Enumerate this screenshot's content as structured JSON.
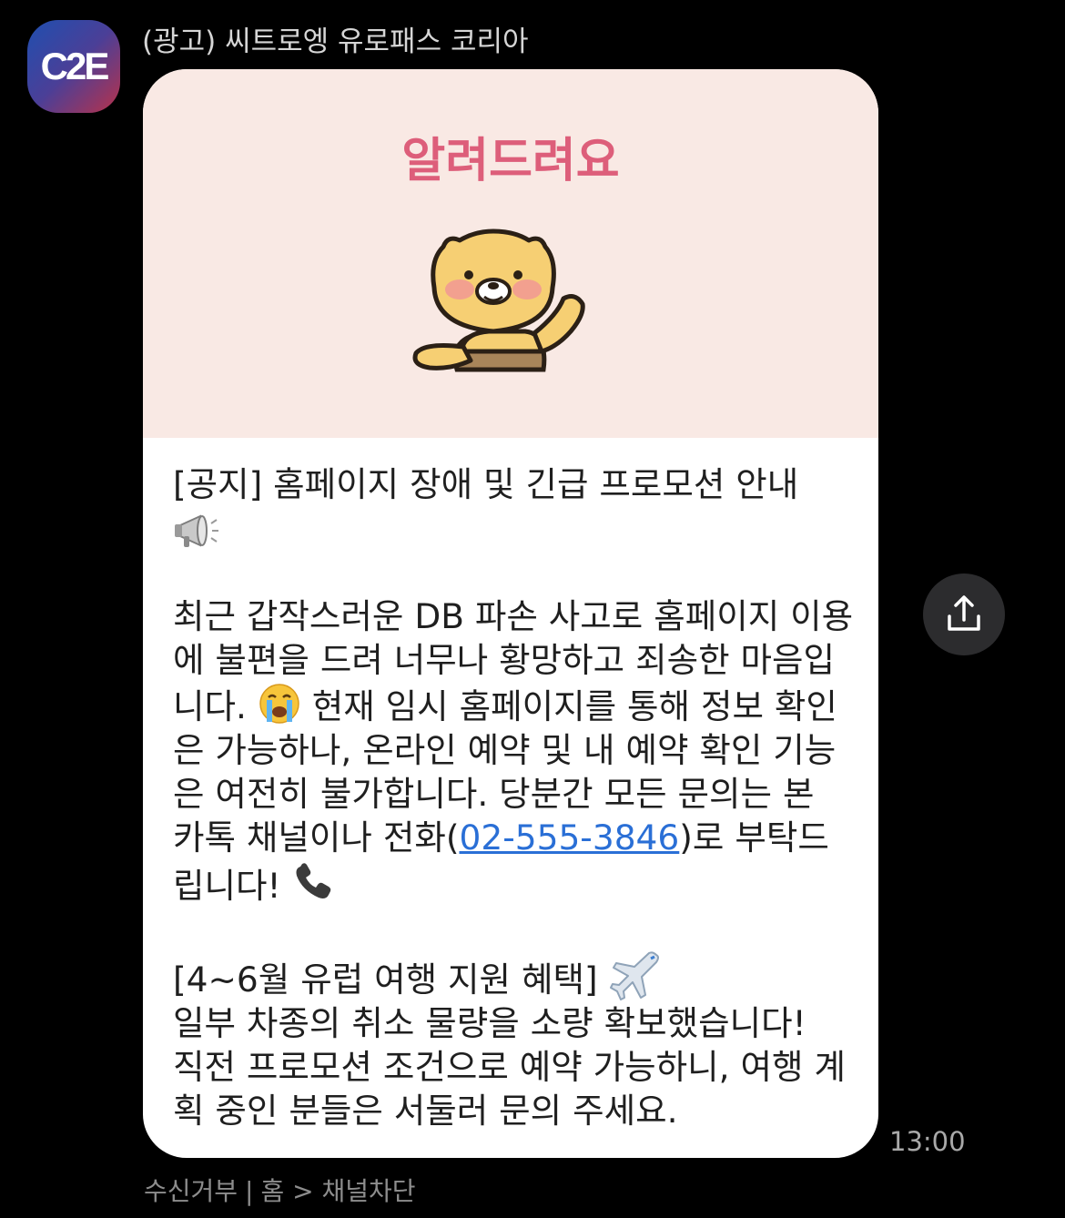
{
  "channel": {
    "avatar_text": "C2E",
    "sender_name": "(광고) 씨트로엥 유로패스 코리아"
  },
  "banner": {
    "title": "알려드려요",
    "background": "#f9e9e4",
    "title_color": "#dd5e7a"
  },
  "message": {
    "notice_title": "[공지] 홈페이지 장애 및 긴급 프로모션 안내",
    "notice_icon": "megaphone-icon",
    "body_part1": "최근 갑작스러운 DB 파손 사고로 홈페이지 이용에 불편을 드려 너무나 황망하고 죄송한 마음입니다.",
    "body_part1_icon": "crying-face-icon",
    "body_part2": "현재 임시 홈페이지를 통해 정보 확인은 가능하나, 온라인 예약 및 내 예약 확인 기능은 여전히 불가합니다. 당분간 모든 문의는 본 카톡 채널이나 전화(",
    "phone_number": "02-555-3846",
    "body_part3": ")로 부탁드립니다!",
    "body_part3_icon": "telephone-icon",
    "promo_title": "[4~6월 유럽 여행 지원 혜택]",
    "promo_icon": "airplane-icon",
    "promo_line1": "일부 차종의 취소 물량을 소량 확보했습니다!",
    "promo_line2": "직전 프로모션 조건으로 예약 가능하니, 여행 계획 중인 분들은 서둘러 문의 주세요."
  },
  "share_button": {
    "icon": "share-icon"
  },
  "timestamp": "13:00",
  "footer": {
    "unsubscribe": "수신거부",
    "separator": "|",
    "home": "홈 >",
    "block": "채널차단"
  },
  "colors": {
    "background": "#000000",
    "bubble": "#ffffff",
    "link": "#2a6fd6"
  }
}
